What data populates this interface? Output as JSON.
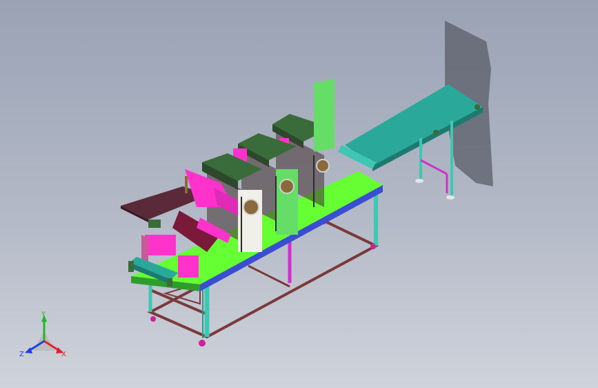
{
  "app": {
    "title": ""
  },
  "viewport": {
    "background_top": "#9aa2b4",
    "background_bottom": "#cfd3db"
  },
  "triad": {
    "x_label": "X",
    "y_label": "Y",
    "z_label": "Z",
    "x_color": "#e0202a",
    "y_color": "#28b428",
    "z_color": "#2040e0"
  },
  "colors": {
    "table_top": "#66ff33",
    "table_edge": "#3a4fd0",
    "frame": "#7a3a3a",
    "legs": "#3fc7b4",
    "conveyor": "#2aa89a",
    "magenta": "#ff33cc",
    "roller_body": "#66dd66",
    "cover": "#3a6b3a",
    "shadow": "#5a5e68"
  }
}
